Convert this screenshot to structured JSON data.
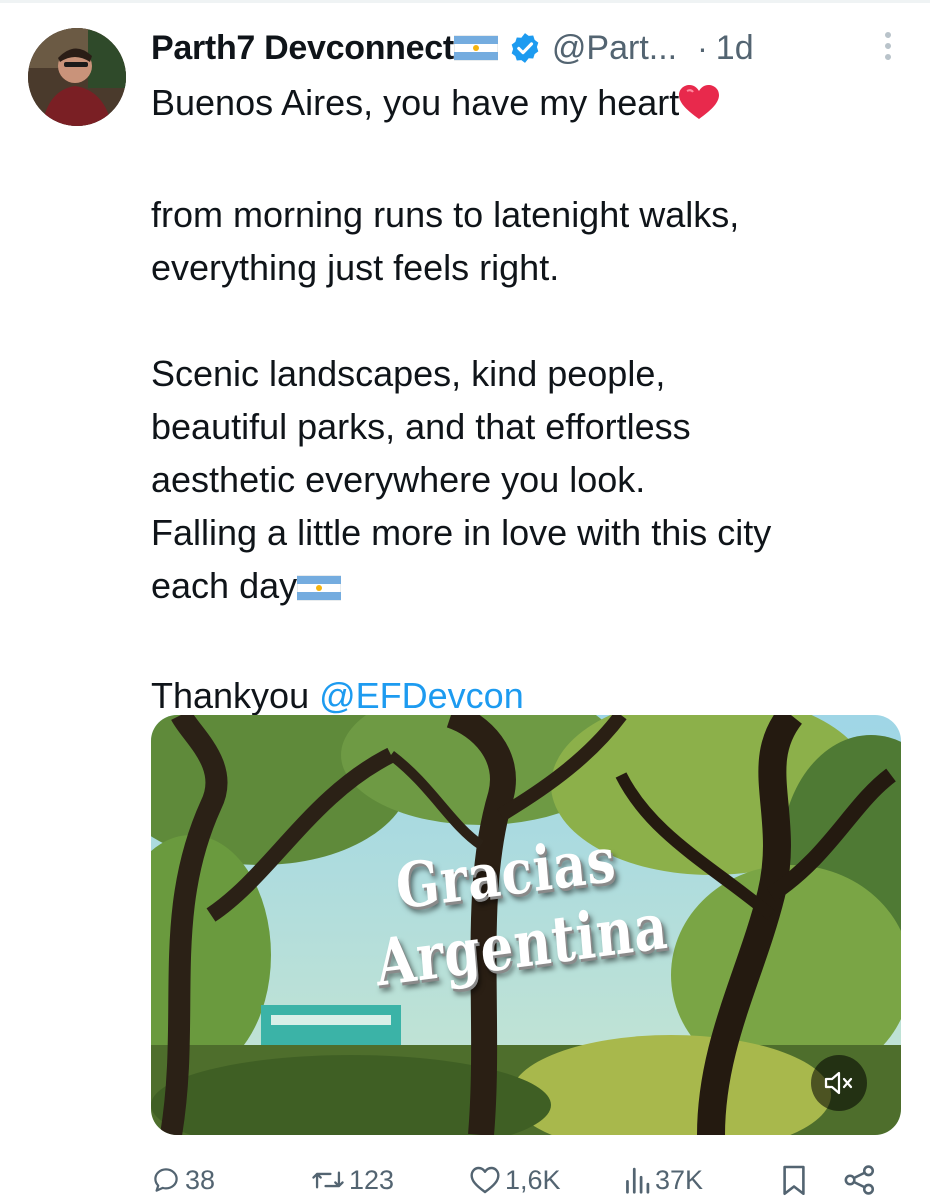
{
  "tweet": {
    "author": {
      "display_name": "Parth7 Devconnect",
      "handle": "@Part...",
      "verified": true
    },
    "separator": "·",
    "timestamp": "1d",
    "text_lines": {
      "line1": "Buenos Aires, you have my heart",
      "line2": "from morning runs to latenight walks,",
      "line3": "everything just feels right.",
      "line4": "Scenic landscapes, kind people,",
      "line5": "beautiful parks, and that effortless",
      "line6": "aesthetic everywhere you look.",
      "line7": "Falling a little more in love with this city",
      "line8": "each day",
      "line9_prefix": "Thankyou ",
      "mention": "@EFDevcon"
    },
    "media": {
      "overlay_line1": "Gracias",
      "overlay_line2": "Argentina"
    },
    "actions": {
      "replies": "38",
      "reposts": "123",
      "likes": "1,6K",
      "views": "37K"
    },
    "colors": {
      "accent": "#1d9bf0",
      "secondary_text": "#536471",
      "primary_text": "#0f1419",
      "heart_emoji": "#e8294c"
    },
    "icons": [
      "verified-badge-icon",
      "more-icon",
      "argentina-flag-icon",
      "heart-emoji-icon",
      "mute-icon",
      "reply-icon",
      "repost-icon",
      "like-icon",
      "views-icon",
      "bookmark-icon",
      "share-icon"
    ]
  }
}
